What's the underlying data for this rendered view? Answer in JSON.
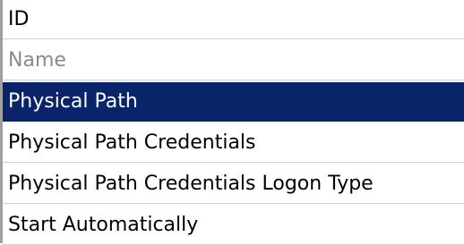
{
  "list": {
    "items": [
      {
        "label": "ID",
        "state": "normal"
      },
      {
        "label": "Name",
        "state": "disabled"
      },
      {
        "label": "Physical Path",
        "state": "selected"
      },
      {
        "label": "Physical Path Credentials",
        "state": "normal"
      },
      {
        "label": "Physical Path Credentials Logon Type",
        "state": "normal"
      },
      {
        "label": "Start Automatically",
        "state": "normal"
      }
    ]
  },
  "colors": {
    "selection_background": "#0a246a",
    "selection_text": "#ffffff",
    "disabled_text": "#8a8a8a",
    "row_separator": "#d4d0c8"
  }
}
